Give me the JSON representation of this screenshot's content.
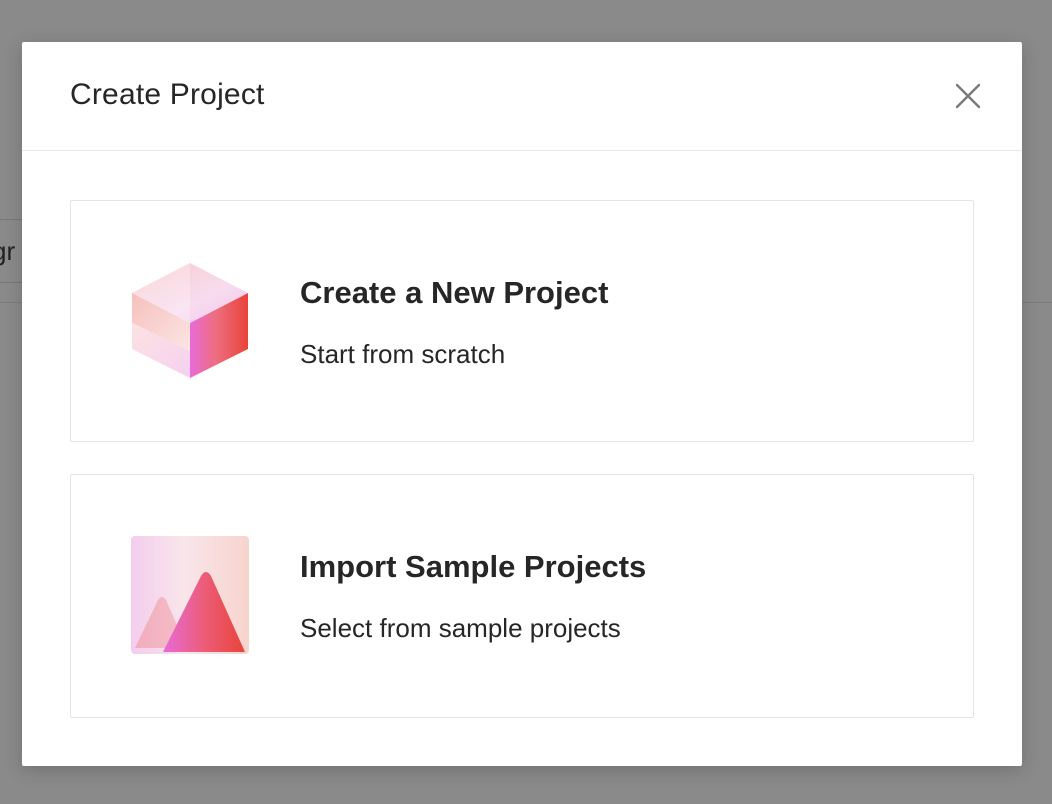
{
  "background": {
    "partial_field_text": "gr"
  },
  "modal": {
    "title": "Create Project",
    "close_icon": "close-icon",
    "options": [
      {
        "title": "Create a New Project",
        "description": "Start from scratch",
        "icon": "cube-icon"
      },
      {
        "title": "Import Sample Projects",
        "description": "Select from sample projects",
        "icon": "mountain-image-icon"
      }
    ]
  },
  "colors": {
    "overlay": "#8a8a8a",
    "accent_red": "#e8443a",
    "accent_pink": "#e86bd8",
    "text": "#262626"
  }
}
